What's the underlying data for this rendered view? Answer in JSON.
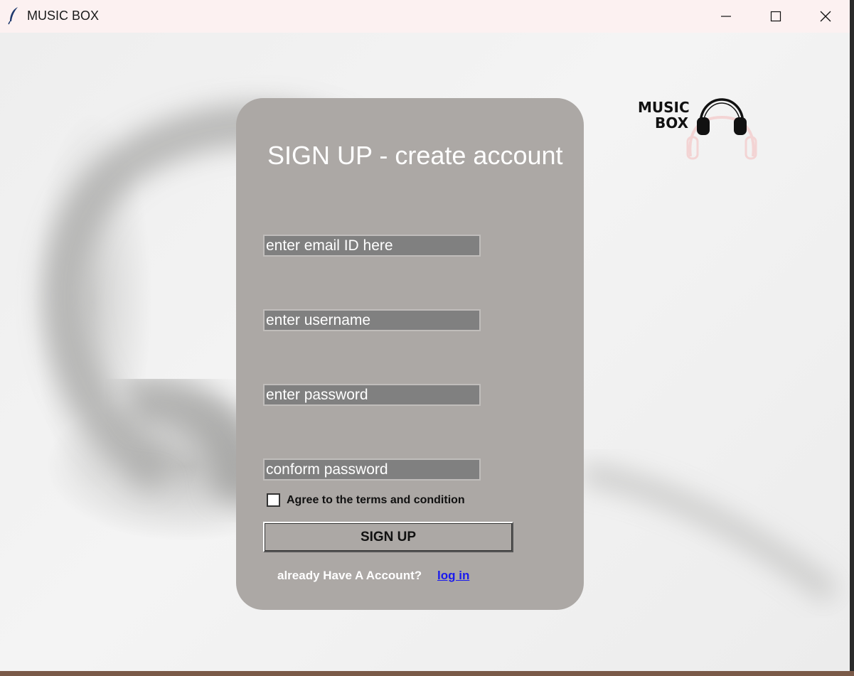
{
  "window": {
    "title": "MUSIC BOX",
    "controls": {
      "minimize": "minimize-icon",
      "maximize": "maximize-icon",
      "close": "close-icon"
    }
  },
  "logo": {
    "line1": "MUSIC",
    "line2": "BOX",
    "icon": "headphones-icon"
  },
  "form": {
    "title": "SIGN UP - create account",
    "email_placeholder": "enter email ID here",
    "username_placeholder": "enter username",
    "password_placeholder": "enter password",
    "confirm_placeholder": "conform password",
    "agree_label": "Agree to the terms and condition",
    "agree_checked": false,
    "signup_label": "SIGN UP",
    "already_text": "already Have A Account?",
    "login_label": "log in"
  },
  "colors": {
    "card": "#aca8a5",
    "field": "#808080",
    "link": "#1a1aee",
    "titlebar": "#fcf1f1"
  }
}
